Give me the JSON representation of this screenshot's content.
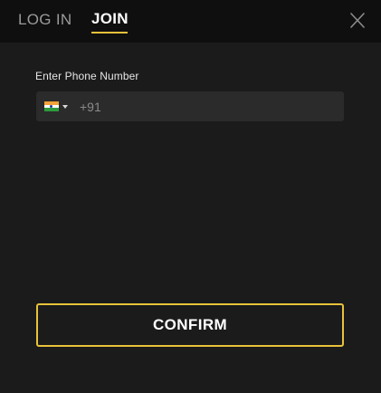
{
  "header": {
    "tabs": [
      {
        "label": "LOG IN",
        "active": false
      },
      {
        "label": "JOIN",
        "active": true
      }
    ],
    "close_icon": "close-icon"
  },
  "form": {
    "phone_label": "Enter Phone Number",
    "country_flag_icon": "india-flag-icon",
    "country_dropdown_icon": "caret-down-icon",
    "phone_value": "",
    "phone_placeholder": "+91"
  },
  "actions": {
    "confirm_label": "CONFIRM"
  },
  "colors": {
    "background": "#1b1b1b",
    "header_background": "#0f0f0f",
    "field_background": "#2b2b2b",
    "accent": "#e8c23a",
    "inactive_tab": "#9a9a9a",
    "text": "#ffffff"
  }
}
